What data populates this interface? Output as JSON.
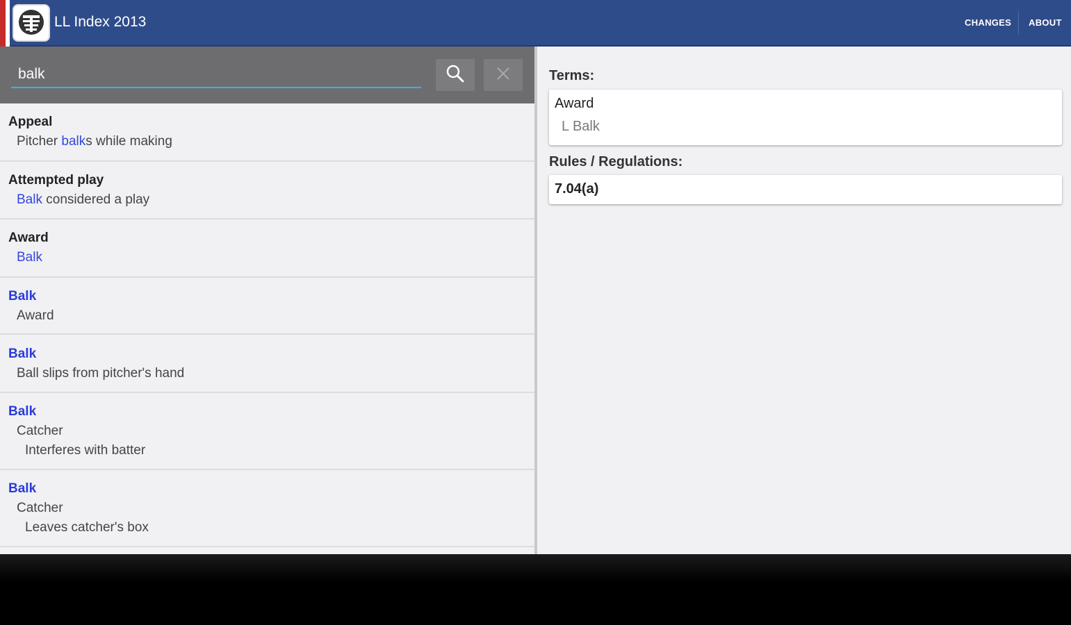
{
  "actionbar": {
    "title": "LL Index 2013",
    "menu": [
      {
        "label": "CHANGES"
      },
      {
        "label": "ABOUT"
      }
    ],
    "logo_icon": "umpire-mask-logo",
    "colors": {
      "bar": "#2f4c8a",
      "stripe": "#c62a2a"
    }
  },
  "search": {
    "value": "balk",
    "search_icon": "search-icon",
    "clear_icon": "close-icon",
    "accent": "#33b5e5"
  },
  "results": [
    {
      "title": "Appeal",
      "title_highlight": false,
      "sub_pre": "Pitcher ",
      "sub_hl": "balk",
      "sub_post": "s while making",
      "sub2": ""
    },
    {
      "title": "Attempted play",
      "title_highlight": false,
      "sub_pre": "",
      "sub_hl": "Balk",
      "sub_post": " considered a play",
      "sub2": ""
    },
    {
      "title": "Award",
      "title_highlight": false,
      "sub_pre": "",
      "sub_hl": "Balk",
      "sub_post": "",
      "sub2": ""
    },
    {
      "title": "Balk",
      "title_highlight": true,
      "sub_pre": "Award",
      "sub_hl": "",
      "sub_post": "",
      "sub2": ""
    },
    {
      "title": "Balk",
      "title_highlight": true,
      "sub_pre": "Ball slips from pitcher's hand",
      "sub_hl": "",
      "sub_post": "",
      "sub2": ""
    },
    {
      "title": "Balk",
      "title_highlight": true,
      "sub_pre": "Catcher",
      "sub_hl": "",
      "sub_post": "",
      "sub2": "Interferes with batter"
    },
    {
      "title": "Balk",
      "title_highlight": true,
      "sub_pre": "Catcher",
      "sub_hl": "",
      "sub_post": "",
      "sub2": "Leaves catcher's box"
    }
  ],
  "detail": {
    "terms_label": "Terms:",
    "term_title": "Award",
    "term_sub": "L Balk",
    "rules_label": "Rules / Regulations:",
    "rule": "7.04(a)"
  }
}
